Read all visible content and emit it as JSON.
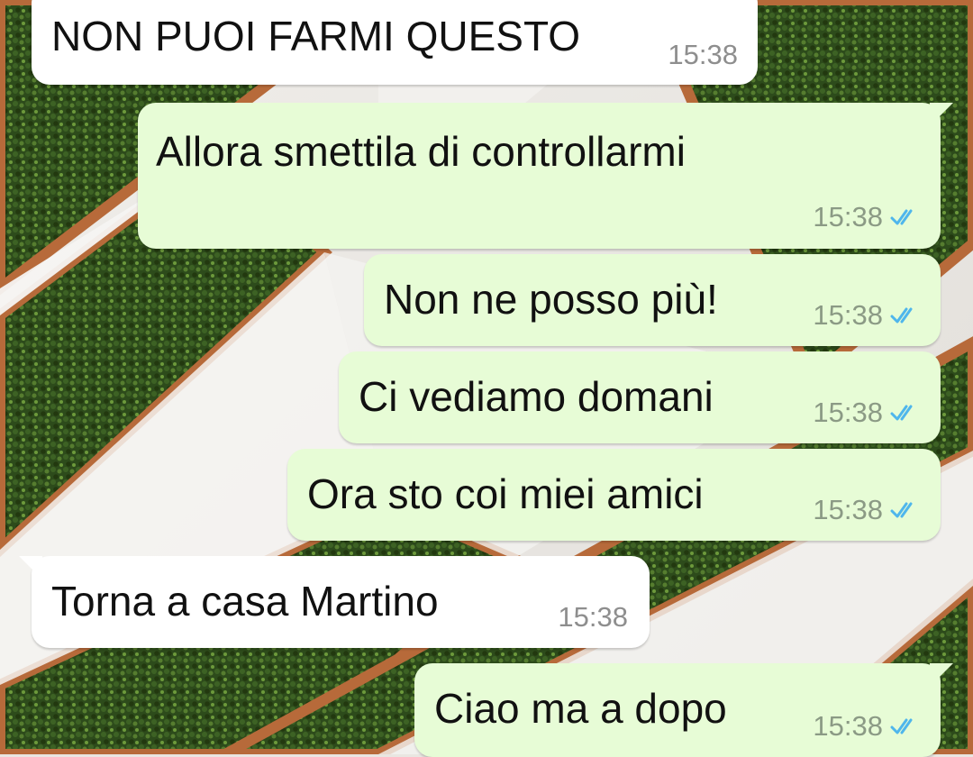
{
  "messages": [
    {
      "direction": "incoming",
      "text": "NON PUOI FARMI QUESTO",
      "time": "15:38"
    },
    {
      "direction": "outgoing",
      "text": "Allora smettila di controllarmi",
      "time": "15:38",
      "status": "read",
      "status_icon": "double-check-icon"
    },
    {
      "direction": "outgoing",
      "text": "Non ne posso più!",
      "time": "15:38",
      "status": "read",
      "status_icon": "double-check-icon"
    },
    {
      "direction": "outgoing",
      "text": "Ci vediamo domani",
      "time": "15:38",
      "status": "read",
      "status_icon": "double-check-icon"
    },
    {
      "direction": "outgoing",
      "text": "Ora sto coi miei amici",
      "time": "15:38",
      "status": "read",
      "status_icon": "double-check-icon"
    },
    {
      "direction": "incoming",
      "text": "Torna a casa Martino",
      "time": "15:38"
    },
    {
      "direction": "outgoing",
      "text": "Ciao ma a dopo",
      "time": "15:38",
      "status": "read",
      "status_icon": "double-check-icon"
    }
  ],
  "colors": {
    "incoming_bubble": "#ffffff",
    "outgoing_bubble": "#e7fcd6",
    "read_ticks": "#4fb6ec",
    "timestamp": "#8e8e8e",
    "wallpaper_green": "#2f4d1c",
    "wallpaper_wood": "#b76a3a",
    "wallpaper_white": "#f3f2ef"
  }
}
